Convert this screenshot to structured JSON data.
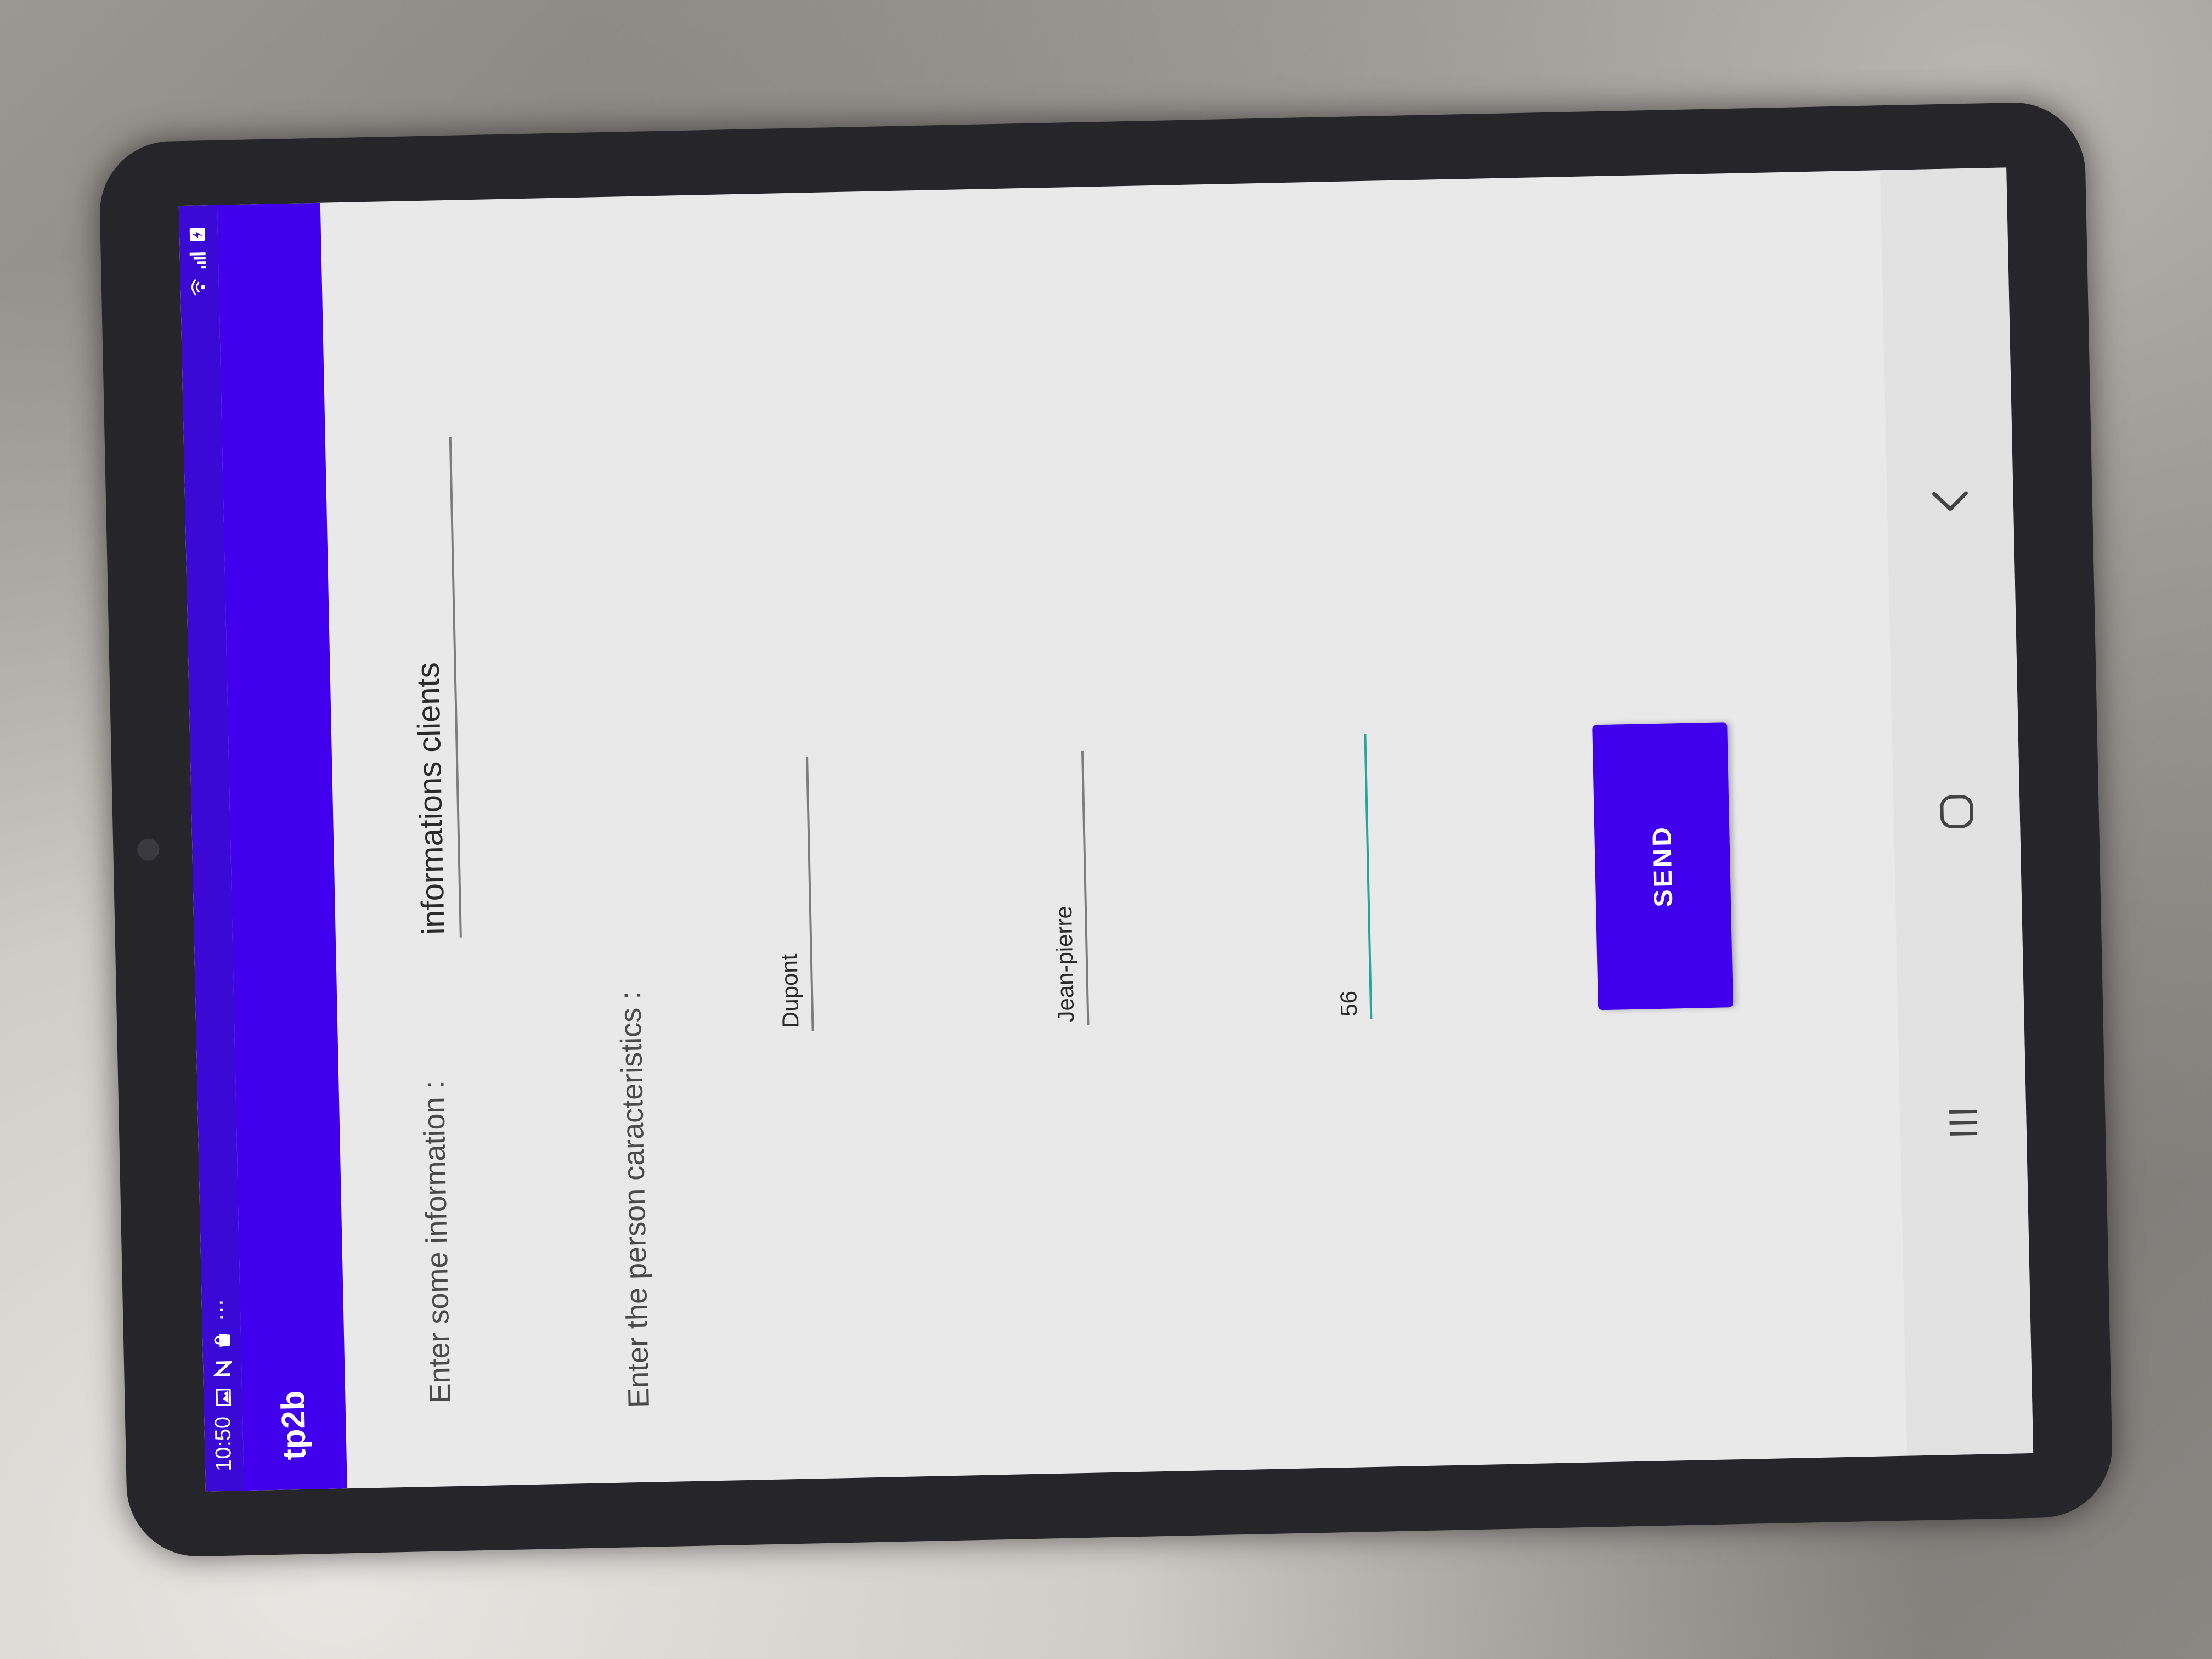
{
  "status_bar": {
    "time": "10:50",
    "notification_icons": [
      "image-icon",
      "n-icon",
      "bag-icon",
      "more-notifications-icon"
    ],
    "more_dots": "⋯",
    "system_icons": [
      "wifi-icon",
      "signal-icon",
      "battery-icon"
    ]
  },
  "app_bar": {
    "title": "tp2b"
  },
  "form": {
    "info_label": "Enter some information :",
    "info_value": "informations clients",
    "person_label": "Enter the person caracteristics :",
    "name_value": "Dupont",
    "firstname_value": "Jean-pierre",
    "age_value": "56",
    "send_label": "SEND"
  },
  "nav_bar": {
    "icons": [
      "recents-icon",
      "home-icon",
      "back-icon"
    ]
  },
  "colors": {
    "primary": "#4100ed",
    "status_bar": "#3a09d6",
    "accent": "#26a69a",
    "background": "#e9e9ea"
  }
}
